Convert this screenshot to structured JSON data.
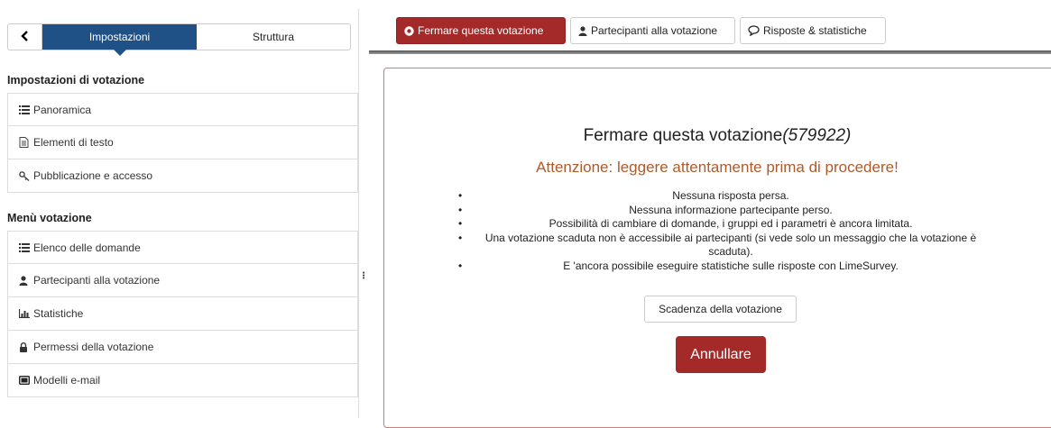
{
  "sidebar": {
    "tabs": {
      "back_icon": "chevron-left-icon",
      "settings": "Impostazioni",
      "structure": "Struttura"
    },
    "settings_section": {
      "title": "Impostazioni di votazione",
      "items": [
        {
          "label": "Panoramica",
          "icon": "list-icon"
        },
        {
          "label": "Elementi di testo",
          "icon": "document-icon"
        },
        {
          "label": "Pubblicazione e accesso",
          "icon": "key-icon"
        }
      ]
    },
    "menu_section": {
      "title": "Menù votazione",
      "items": [
        {
          "label": "Elenco delle domande",
          "icon": "list-icon"
        },
        {
          "label": "Partecipanti alla votazione",
          "icon": "user-icon"
        },
        {
          "label": "Statistiche",
          "icon": "bar-chart-icon"
        },
        {
          "label": "Permessi della votazione",
          "icon": "lock-icon"
        },
        {
          "label": "Modelli e-mail",
          "icon": "email-template-icon"
        }
      ]
    }
  },
  "toolbar": {
    "stop_label": "Fermare questa votazione",
    "participants_label": "Partecipanti alla votazione",
    "responses_label": "Risposte & statistiche"
  },
  "main": {
    "title_text": "Fermare questa votazione",
    "survey_id": "(579922)",
    "warning": "Attenzione: leggere attentamente prima di procedere!",
    "bullets": [
      "Nessuna risposta persa.",
      "Nessuna informazione partecipante perso.",
      "Possibilità di cambiare di domande, i gruppi ed i parametri è ancora limitata.",
      "Una votazione scaduta non è accessibile ai partecipanti (si vede solo un messaggio che la votazione è scaduta).",
      "E 'ancora possibile eseguire statistiche sulle risposte con LimeSurvey."
    ],
    "expire_button": "Scadenza della votazione",
    "cancel_button": "Annullare"
  },
  "colors": {
    "brand_blue": "#1f5186",
    "danger_red": "#a32a29",
    "warning_text": "#b05a2a"
  }
}
